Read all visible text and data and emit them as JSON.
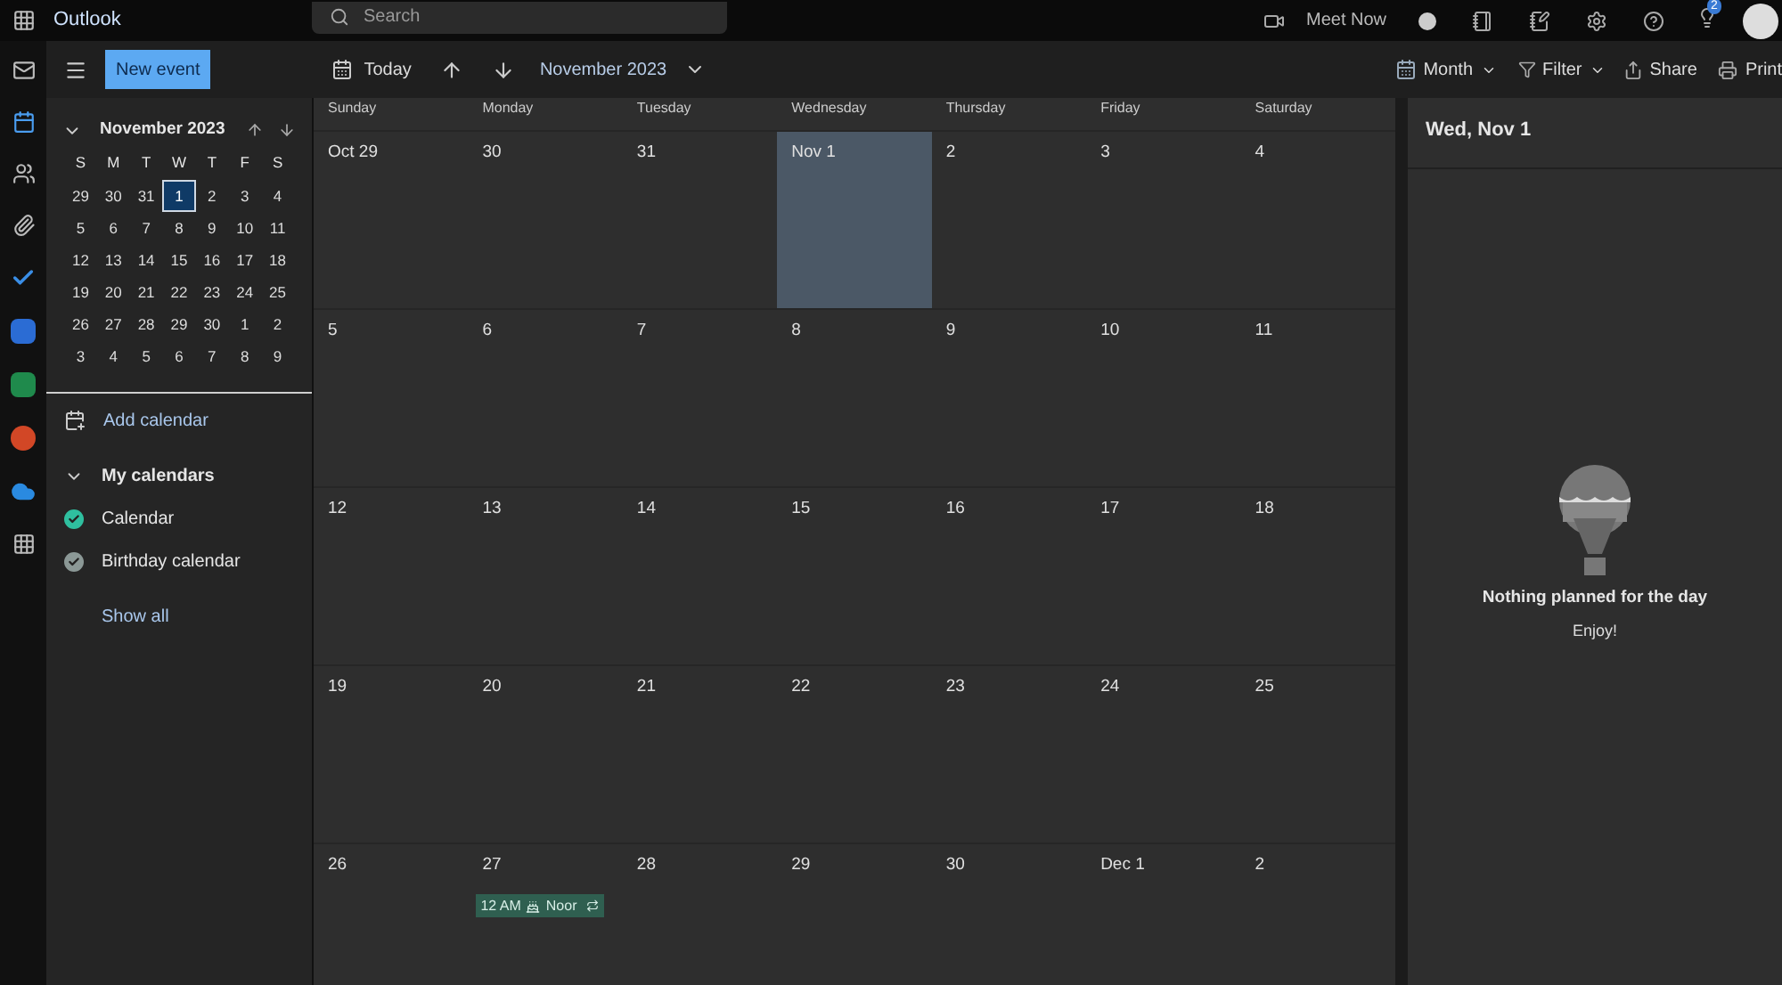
{
  "top_bar": {
    "app_name": "Outlook",
    "search": {
      "placeholder": "Search"
    },
    "meet_now": "Meet Now",
    "notification_badge": "2"
  },
  "toolbar": {
    "new_event": "New event",
    "today": "Today",
    "period": "November 2023",
    "view": "Month",
    "filter": "Filter",
    "share": "Share",
    "print": "Print"
  },
  "mini_calendar": {
    "title": "November 2023",
    "weekdays": [
      "S",
      "M",
      "T",
      "W",
      "T",
      "F",
      "S"
    ],
    "weeks": [
      [
        {
          "label": "29",
          "selected": false
        },
        {
          "label": "30",
          "selected": false
        },
        {
          "label": "31",
          "selected": false
        },
        {
          "label": "1",
          "selected": true
        },
        {
          "label": "2",
          "selected": false
        },
        {
          "label": "3",
          "selected": false
        },
        {
          "label": "4",
          "selected": false
        }
      ],
      [
        {
          "label": "5",
          "selected": false
        },
        {
          "label": "6",
          "selected": false
        },
        {
          "label": "7",
          "selected": false
        },
        {
          "label": "8",
          "selected": false
        },
        {
          "label": "9",
          "selected": false
        },
        {
          "label": "10",
          "selected": false
        },
        {
          "label": "11",
          "selected": false
        }
      ],
      [
        {
          "label": "12",
          "selected": false
        },
        {
          "label": "13",
          "selected": false
        },
        {
          "label": "14",
          "selected": false
        },
        {
          "label": "15",
          "selected": false
        },
        {
          "label": "16",
          "selected": false
        },
        {
          "label": "17",
          "selected": false
        },
        {
          "label": "18",
          "selected": false
        }
      ],
      [
        {
          "label": "19",
          "selected": false
        },
        {
          "label": "20",
          "selected": false
        },
        {
          "label": "21",
          "selected": false
        },
        {
          "label": "22",
          "selected": false
        },
        {
          "label": "23",
          "selected": false
        },
        {
          "label": "24",
          "selected": false
        },
        {
          "label": "25",
          "selected": false
        }
      ],
      [
        {
          "label": "26",
          "selected": false
        },
        {
          "label": "27",
          "selected": false
        },
        {
          "label": "28",
          "selected": false
        },
        {
          "label": "29",
          "selected": false
        },
        {
          "label": "30",
          "selected": false
        },
        {
          "label": "1",
          "selected": false
        },
        {
          "label": "2",
          "selected": false
        }
      ],
      [
        {
          "label": "3",
          "selected": false
        },
        {
          "label": "4",
          "selected": false
        },
        {
          "label": "5",
          "selected": false
        },
        {
          "label": "6",
          "selected": false
        },
        {
          "label": "7",
          "selected": false
        },
        {
          "label": "8",
          "selected": false
        },
        {
          "label": "9",
          "selected": false
        }
      ]
    ]
  },
  "add_calendar": "Add calendar",
  "my_calendars": {
    "title": "My calendars",
    "items": [
      {
        "name": "Calendar",
        "color": "#2fbf9f"
      },
      {
        "name": "Birthday calendar",
        "color": "#8b9896"
      }
    ],
    "show_all": "Show all"
  },
  "month_grid": {
    "weekdays": [
      "Sunday",
      "Monday",
      "Tuesday",
      "Wednesday",
      "Thursday",
      "Friday",
      "Saturday"
    ],
    "weeks": [
      [
        {
          "label": "Oct 29",
          "selected": false
        },
        {
          "label": "30",
          "selected": false
        },
        {
          "label": "31",
          "selected": false
        },
        {
          "label": "Nov 1",
          "selected": true
        },
        {
          "label": "2",
          "selected": false
        },
        {
          "label": "3",
          "selected": false
        },
        {
          "label": "4",
          "selected": false
        }
      ],
      [
        {
          "label": "5",
          "selected": false
        },
        {
          "label": "6",
          "selected": false
        },
        {
          "label": "7",
          "selected": false
        },
        {
          "label": "8",
          "selected": false
        },
        {
          "label": "9",
          "selected": false
        },
        {
          "label": "10",
          "selected": false
        },
        {
          "label": "11",
          "selected": false
        }
      ],
      [
        {
          "label": "12",
          "selected": false
        },
        {
          "label": "13",
          "selected": false
        },
        {
          "label": "14",
          "selected": false
        },
        {
          "label": "15",
          "selected": false
        },
        {
          "label": "16",
          "selected": false
        },
        {
          "label": "17",
          "selected": false
        },
        {
          "label": "18",
          "selected": false
        }
      ],
      [
        {
          "label": "19",
          "selected": false
        },
        {
          "label": "20",
          "selected": false
        },
        {
          "label": "21",
          "selected": false
        },
        {
          "label": "22",
          "selected": false
        },
        {
          "label": "23",
          "selected": false
        },
        {
          "label": "24",
          "selected": false
        },
        {
          "label": "25",
          "selected": false
        }
      ],
      [
        {
          "label": "26",
          "selected": false
        },
        {
          "label": "27",
          "selected": false,
          "events": [
            {
              "time": "12 AM",
              "title": "Noor"
            }
          ]
        },
        {
          "label": "28",
          "selected": false
        },
        {
          "label": "29",
          "selected": false
        },
        {
          "label": "30",
          "selected": false
        },
        {
          "label": "Dec 1",
          "selected": false
        },
        {
          "label": "2",
          "selected": false
        }
      ]
    ]
  },
  "day_pane": {
    "title": "Wed, Nov 1",
    "empty_title": "Nothing planned for the day",
    "empty_subtitle": "Enjoy!"
  }
}
